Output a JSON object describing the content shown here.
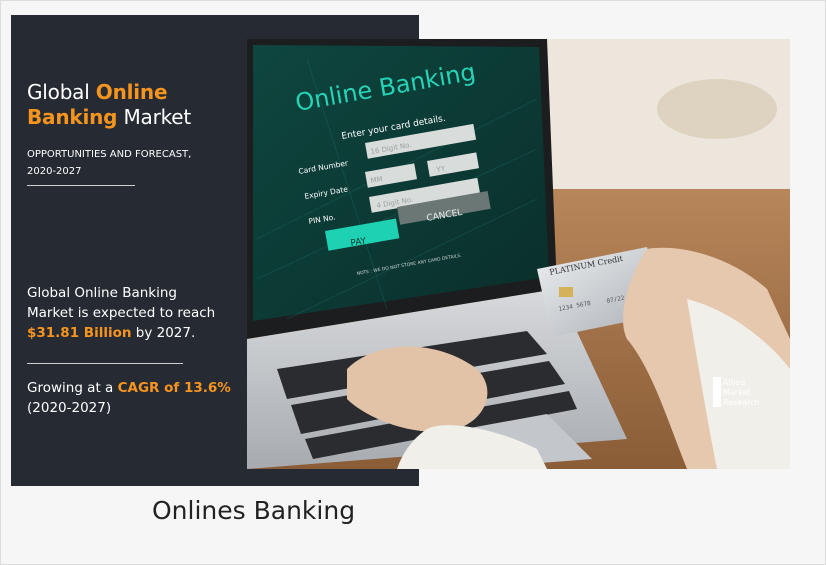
{
  "banner": {
    "title_line1_a": "Global ",
    "title_line1_b": "Online",
    "title_line2_a": "Banking",
    "title_line2_b": " Market",
    "subtitle_line1": "OPPORTUNITIES AND FORECAST,",
    "subtitle_line2": "2020-2027",
    "stat1_line1": "Global Online Banking",
    "stat1_line2": "Market is expected to reach",
    "stat1_highlight": "$31.81 Billion",
    "stat1_suffix": " by 2027.",
    "stat2_prefix": "Growing at a ",
    "stat2_highlight": "CAGR of 13.6%",
    "stat2_line2": "(2020-2027)"
  },
  "screen": {
    "heading": "Online Banking",
    "prompt": "Enter your card details.",
    "card_label": "Card Number",
    "card_placeholder": "16 Digit No.",
    "expiry_label": "Expiry Date",
    "mm_placeholder": "MM",
    "yy_placeholder": "YY",
    "pin_label": "PIN No.",
    "pin_placeholder": "4 Digit No.",
    "cancel_label": "CANCEL",
    "pay_label": "PAY",
    "note": "NOTE : WE DO NOT STORE ANY CARD DETAILS."
  },
  "card": {
    "brand": "PLATINUM Credit",
    "number": "1234 5678",
    "expiry": "07/22"
  },
  "logo": {
    "line1": "Allied",
    "line2": "Market",
    "line3": "Research"
  },
  "caption": "Onlines Banking",
  "colors": {
    "banner_bg": "#262b33",
    "accent": "#f7941d",
    "screen_bg": "#0f3b36",
    "pay_button": "#1fd1b3",
    "cancel_button": "#6a7775"
  }
}
